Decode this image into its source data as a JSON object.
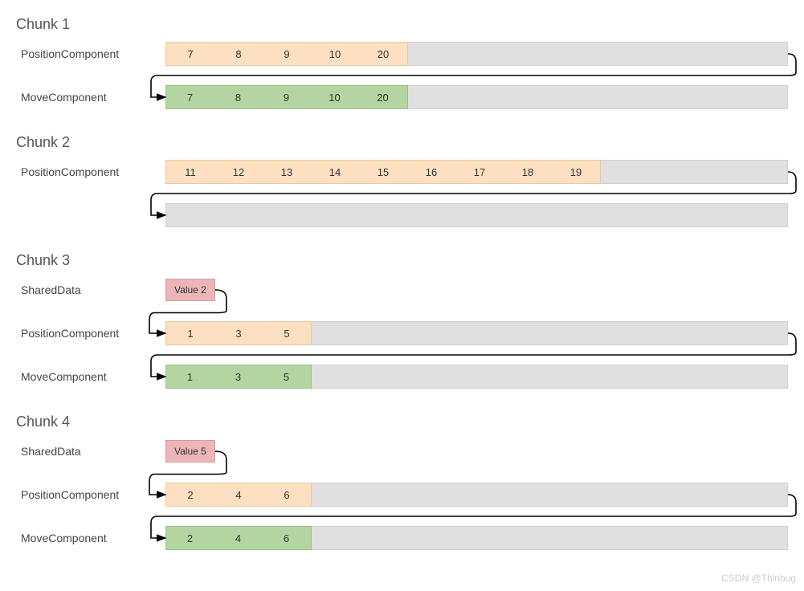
{
  "watermark": "CSDN @Thinbug",
  "labels": {
    "position": "PositionComponent",
    "move": "MoveComponent",
    "shared": "SharedData"
  },
  "chunks": [
    {
      "title": "Chunk 1",
      "rows": [
        {
          "type": "position",
          "values": [
            "7",
            "8",
            "9",
            "10",
            "20"
          ]
        },
        {
          "type": "move",
          "values": [
            "7",
            "8",
            "9",
            "10",
            "20"
          ]
        }
      ]
    },
    {
      "title": "Chunk 2",
      "rows": [
        {
          "type": "position",
          "values": [
            "11",
            "12",
            "13",
            "14",
            "15",
            "16",
            "17",
            "18",
            "19"
          ]
        },
        {
          "type": "empty"
        }
      ]
    },
    {
      "title": "Chunk 3",
      "shared": "Value 2",
      "rows": [
        {
          "type": "position",
          "values": [
            "1",
            "3",
            "5"
          ]
        },
        {
          "type": "move",
          "values": [
            "1",
            "3",
            "5"
          ]
        }
      ]
    },
    {
      "title": "Chunk 4",
      "shared": "Value 5",
      "rows": [
        {
          "type": "position",
          "values": [
            "2",
            "4",
            "6"
          ]
        },
        {
          "type": "move",
          "values": [
            "2",
            "4",
            "6"
          ]
        }
      ]
    }
  ]
}
